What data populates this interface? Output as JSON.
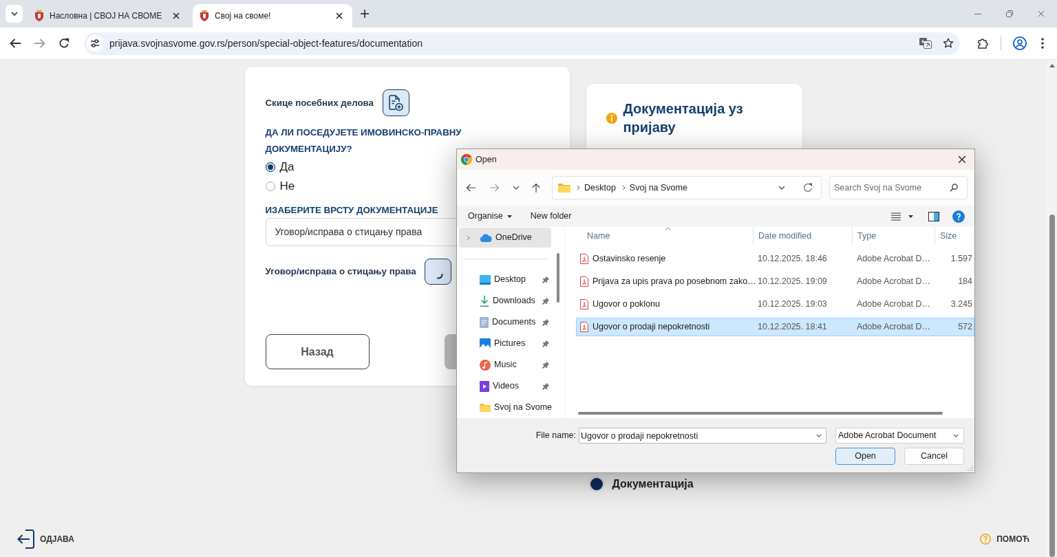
{
  "browser": {
    "tabs": [
      {
        "title": "Насловна | СВОЈ НА СВОМЕ",
        "selected": false
      },
      {
        "title": "Свој на своме!",
        "selected": true
      }
    ],
    "url": "prijava.svojnasvome.gov.rs/person/special-object-features/documentation"
  },
  "form": {
    "sketch_label": "Скице посебних делова",
    "question": "ДА ЛИ ПОСЕДУЈЕТЕ ИМОВИНСКО-ПРАВНУ ДОКУМЕНТАЦИЈУ?",
    "answers": [
      {
        "label": "Да",
        "selected": true
      },
      {
        "label": "Не",
        "selected": false
      }
    ],
    "type_label": "ИЗАБЕРИТЕ ВРСТУ ДОКУМЕНТАЦИЈЕ",
    "type_value": "Уговор/исправа о стицању права",
    "upload_label": "Уговор/исправа о стицању права",
    "back_button": "Назад"
  },
  "side_panel": {
    "title": "Документација уз пријаву",
    "steps": [
      {
        "label": "Документација",
        "current": true
      }
    ]
  },
  "footer": {
    "logout": "ОДЈАВА",
    "help": "ПОМОЋ"
  },
  "dialog": {
    "title": "Open",
    "path": [
      "Desktop",
      "Svoj na Svome"
    ],
    "search_placeholder": "Search Svoj na Svome",
    "toolbar": {
      "organise": "Organise",
      "new_folder": "New folder"
    },
    "nav_groups": [
      {
        "items": [
          {
            "label": "OneDrive",
            "kind": "cloud",
            "selected": true,
            "pinned": false,
            "expanded": false
          }
        ]
      },
      {
        "items": [
          {
            "label": "Desktop",
            "kind": "desktop",
            "selected": false,
            "pinned": true
          },
          {
            "label": "Downloads",
            "kind": "downloads",
            "selected": false,
            "pinned": true
          },
          {
            "label": "Documents",
            "kind": "documents",
            "selected": false,
            "pinned": true
          },
          {
            "label": "Pictures",
            "kind": "pictures",
            "selected": false,
            "pinned": true
          },
          {
            "label": "Music",
            "kind": "music",
            "selected": false,
            "pinned": true
          },
          {
            "label": "Videos",
            "kind": "videos",
            "selected": false,
            "pinned": true
          },
          {
            "label": "Svoj na Svome",
            "kind": "folder",
            "selected": false,
            "pinned": false
          }
        ]
      }
    ],
    "columns": [
      {
        "label": "Name",
        "sorted": true
      },
      {
        "label": "Date modified",
        "sorted": false
      },
      {
        "label": "Type",
        "sorted": false
      },
      {
        "label": "Size",
        "sorted": false
      }
    ],
    "files": [
      {
        "name": "Ostavinsko resenje",
        "date": "10.12.2025. 18:46",
        "type": "Adobe Acrobat D…",
        "size": "1.597",
        "selected": false
      },
      {
        "name": "Prijava za upis prava po posebnom zako…",
        "date": "10.12.2025. 19:09",
        "type": "Adobe Acrobat D…",
        "size": "184",
        "selected": false
      },
      {
        "name": "Ugovor o poklonu",
        "date": "10.12.2025. 19:03",
        "type": "Adobe Acrobat D…",
        "size": "3.245",
        "selected": false
      },
      {
        "name": "Ugovor o prodaji nepokretnosti",
        "date": "10.12.2025. 18:41",
        "type": "Adobe Acrobat D…",
        "size": "572",
        "selected": true
      }
    ],
    "file_name_label": "File name:",
    "file_name": "Ugovor o prodaji nepokretnosti",
    "file_type": "Adobe Acrobat Document",
    "buttons": [
      {
        "label": "Open",
        "default": true
      },
      {
        "label": "Cancel",
        "default": false
      }
    ]
  }
}
